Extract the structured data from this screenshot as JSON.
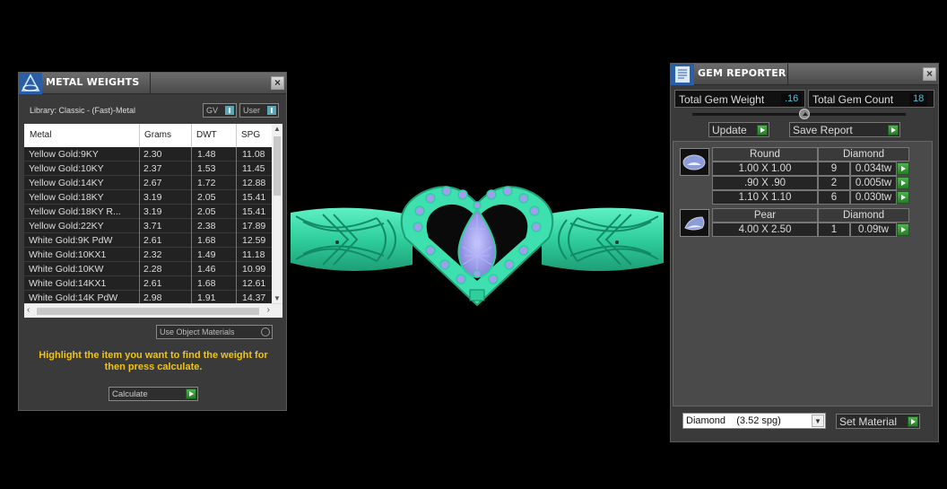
{
  "metal_panel": {
    "title": "METAL WEIGHTS",
    "library": "Library: Classic - (Fast)-Metal",
    "toggle_gv": "GV",
    "toggle_user": "User",
    "columns": [
      "Metal",
      "Grams",
      "DWT",
      "SPG"
    ],
    "rows": [
      {
        "metal": "Yellow Gold:9KY",
        "grams": "2.30",
        "dwt": "1.48",
        "spg": "11.08"
      },
      {
        "metal": "Yellow Gold:10KY",
        "grams": "2.37",
        "dwt": "1.53",
        "spg": "11.45"
      },
      {
        "metal": "Yellow Gold:14KY",
        "grams": "2.67",
        "dwt": "1.72",
        "spg": "12.88"
      },
      {
        "metal": "Yellow Gold:18KY",
        "grams": "3.19",
        "dwt": "2.05",
        "spg": "15.41"
      },
      {
        "metal": "Yellow Gold:18KY R...",
        "grams": "3.19",
        "dwt": "2.05",
        "spg": "15.41"
      },
      {
        "metal": "Yellow Gold:22KY",
        "grams": "3.71",
        "dwt": "2.38",
        "spg": "17.89"
      },
      {
        "metal": "White Gold:9K PdW",
        "grams": "2.61",
        "dwt": "1.68",
        "spg": "12.59"
      },
      {
        "metal": "White Gold:10KX1",
        "grams": "2.32",
        "dwt": "1.49",
        "spg": "11.18"
      },
      {
        "metal": "White Gold:10KW",
        "grams": "2.28",
        "dwt": "1.46",
        "spg": "10.99"
      },
      {
        "metal": "White Gold:14KX1",
        "grams": "2.61",
        "dwt": "1.68",
        "spg": "12.61"
      },
      {
        "metal": "White Gold:14K PdW",
        "grams": "2.98",
        "dwt": "1.91",
        "spg": "14.37"
      }
    ],
    "use_object_materials": "Use Object Materials",
    "hint": "Highlight the item you want to find the weight for then press calculate.",
    "calculate": "Calculate"
  },
  "gem_panel": {
    "title": "GEM REPORTER",
    "total_weight_label": "Total Gem Weight",
    "total_weight_value": ".16",
    "total_count_label": "Total Gem Count",
    "total_count_value": "18",
    "update": "Update",
    "save_report": "Save Report",
    "groups": [
      {
        "shape": "Round",
        "material": "Diamond",
        "items": [
          {
            "size": "1.00 X 1.00",
            "count": "9",
            "weight": "0.034tw"
          },
          {
            "size": ".90 X .90",
            "count": "2",
            "weight": "0.005tw"
          },
          {
            "size": "1.10 X 1.10",
            "count": "6",
            "weight": "0.030tw"
          }
        ]
      },
      {
        "shape": "Pear",
        "material": "Diamond",
        "items": [
          {
            "size": "4.00 X 2.50",
            "count": "1",
            "weight": "0.09tw"
          }
        ]
      }
    ],
    "material_select": "Diamond    (3.52 spg)",
    "set_material": "Set Material"
  },
  "colors": {
    "ring": "#3fe0b0",
    "gem": "#9f9ff0",
    "accent_value": "#4ec5d6",
    "hint": "#f1c40f",
    "go_button": "#3a9a3a"
  }
}
